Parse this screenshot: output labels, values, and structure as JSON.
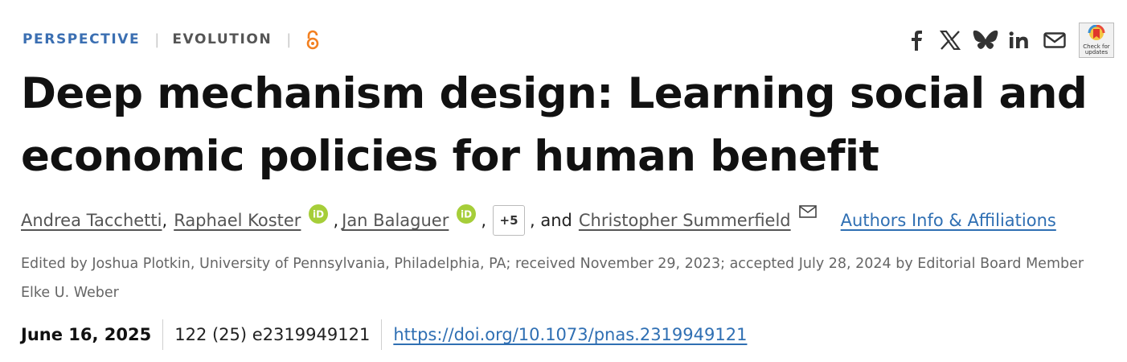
{
  "article": {
    "type": "PERSPECTIVE",
    "subject": "EVOLUTION",
    "separator": "|",
    "title": "Deep mechanism design: Learning social and economic policies for human benefit"
  },
  "share": {
    "icons": [
      "facebook-icon",
      "x-icon",
      "bluesky-icon",
      "linkedin-icon",
      "email-icon"
    ],
    "check_for_updates": {
      "line1": "Check for",
      "line2": "updates"
    }
  },
  "authors": {
    "list": [
      "Andrea Tacchetti",
      "Raphael Koster",
      "Jan Balaguer",
      "Christopher Summerfield"
    ],
    "comma": ",",
    "more": "+5",
    "and": ", and",
    "affiliations_link": "Authors Info & Affiliations"
  },
  "edited_by": "Edited by Joshua Plotkin, University of Pennsylvania, Philadelphia, PA; received November 29, 2023; accepted July 28, 2024 by Editorial Board Member Elke U. Weber",
  "publication": {
    "date": "June 16, 2025",
    "citation": "122 (25) e2319949121",
    "doi": "https://doi.org/10.1073/pnas.2319949121"
  },
  "colors": {
    "accent_blue": "#2f6fb3",
    "open_access_orange": "#f38020",
    "orcid_green": "#a6ce39"
  }
}
